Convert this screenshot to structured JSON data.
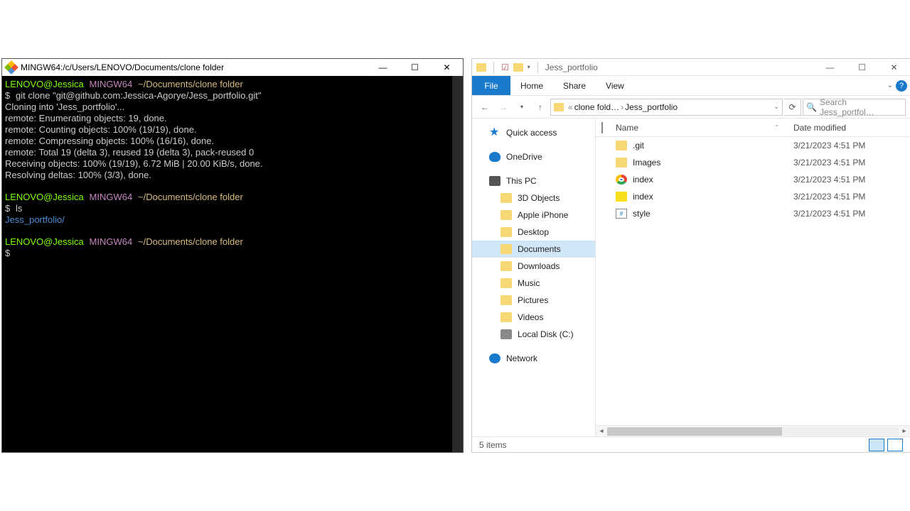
{
  "terminal": {
    "title": "MINGW64:/c/Users/LENOVO/Documents/clone folder",
    "prompt_user": "LENOVO@Jessica",
    "prompt_host": "MINGW64",
    "prompt_path": "~/Documents/clone folder",
    "cmd1": "git clone \"git@github.com:Jessica-Agorye/Jess_portfolio.git\"",
    "out1": "Cloning into 'Jess_portfolio'...",
    "out2": "remote: Enumerating objects: 19, done.",
    "out3": "remote: Counting objects: 100% (19/19), done.",
    "out4": "remote: Compressing objects: 100% (16/16), done.",
    "out5": "remote: Total 19 (delta 3), reused 19 (delta 3), pack-reused 0",
    "out6": "Receiving objects: 100% (19/19), 6.72 MiB | 20.00 KiB/s, done.",
    "out7": "Resolving deltas: 100% (3/3), done.",
    "cmd2": "ls",
    "lsout": "Jess_portfolio/",
    "dollar": "$"
  },
  "explorer": {
    "title": "Jess_portfolio",
    "tabs": {
      "file": "File",
      "home": "Home",
      "share": "Share",
      "view": "View"
    },
    "crumb1": "clone fold…",
    "crumb2": "Jess_portfolio",
    "search_placeholder": "Search Jess_portfol…",
    "cols": {
      "name": "Name",
      "date": "Date modified"
    },
    "nav": {
      "quick": "Quick access",
      "onedrive": "OneDrive",
      "thispc": "This PC",
      "pc_items": [
        "3D Objects",
        "Apple iPhone",
        "Desktop",
        "Documents",
        "Downloads",
        "Music",
        "Pictures",
        "Videos",
        "Local Disk (C:)"
      ],
      "network": "Network"
    },
    "files": [
      {
        "icon": "folder",
        "name": ".git",
        "date": "3/21/2023 4:51 PM"
      },
      {
        "icon": "folder",
        "name": "Images",
        "date": "3/21/2023 4:51 PM"
      },
      {
        "icon": "chrome",
        "name": "index",
        "date": "3/21/2023 4:51 PM"
      },
      {
        "icon": "js",
        "name": "index",
        "date": "3/21/2023 4:51 PM"
      },
      {
        "icon": "css",
        "name": "style",
        "date": "3/21/2023 4:51 PM"
      }
    ],
    "status": "5 items"
  }
}
